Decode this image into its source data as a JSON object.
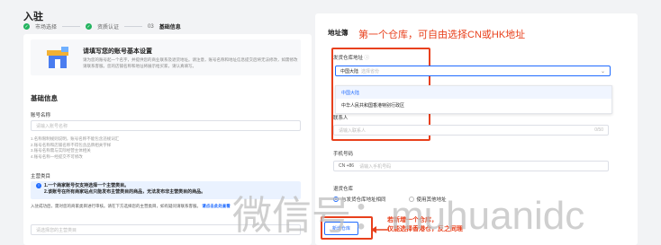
{
  "header": {
    "title": "入驻",
    "steps": [
      {
        "label": "市场选择",
        "state": "done"
      },
      {
        "label": "资质认证",
        "state": "done"
      },
      {
        "number": "03",
        "label": "基础信息",
        "state": "active"
      }
    ]
  },
  "intro": {
    "title": "请填写您的账号基本设置",
    "desc": "请为您的账号起一个名字，并提供您的商业联系及退货地址。请注意，账号名称和地址信息提交后将无法修改，如需修改请联系客服。您的店铺名称和地址将展示给买家，请认真填写。"
  },
  "basic": {
    "section_title": "基础信息",
    "account_label": "账号名称",
    "account_placeholder": "请输入账号名称",
    "hint_lines": [
      "1.名称限制规则说明，账号名称不能包含违规词汇",
      "2.账号名称和店铺名称不得包含品牌相关字样",
      "3.账号名称需与实际经营主体相关",
      "4.账号名称一经提交不可修改"
    ],
    "category_label": "主营类目",
    "notice_line1": "1.一个商家账号仅支持选择一个主营类目。",
    "notice_line2": "2.该账号在所有商家站点只能发布主营类目的商品，无法发布非主营类目的商品。",
    "cat_desc": "入驻成功后，需对您的商家类目进行审核。请在下方选择您的主营类目，如有疑问请联系客服。",
    "cat_link": "请点击此处查看",
    "cat_placeholder": "请选择您的主营类目"
  },
  "address": {
    "title": "地址簿",
    "annot_top": "第一个仓库，可自由选择CN或HK地址",
    "warehouse_label": "发货仓库地址",
    "select_value": "中国大陆",
    "select_placeholder": "选择省份",
    "options": [
      "中国大陆",
      "中华人民共和国香港特别行政区"
    ],
    "contact_label": "联系人",
    "contact_placeholder": "请输入联系人",
    "contact_counter": "0/50",
    "phone_label": "手机号码",
    "phone_code": "CN +86",
    "phone_placeholder": "请输入手机号码",
    "return_label": "退货仓库",
    "return_opt1": "与发货仓库地址相同",
    "return_opt2": "使用其他地址",
    "add_button": "新增仓库",
    "annot_bottom1": "若新增一个仓库，",
    "annot_bottom2": "仅能选择香港仓，反之同理"
  },
  "watermark": "微信号：muhuanidc",
  "colors": {
    "accent": "#1f6bff",
    "annotation": "#e8401c",
    "success": "#22b35e"
  }
}
